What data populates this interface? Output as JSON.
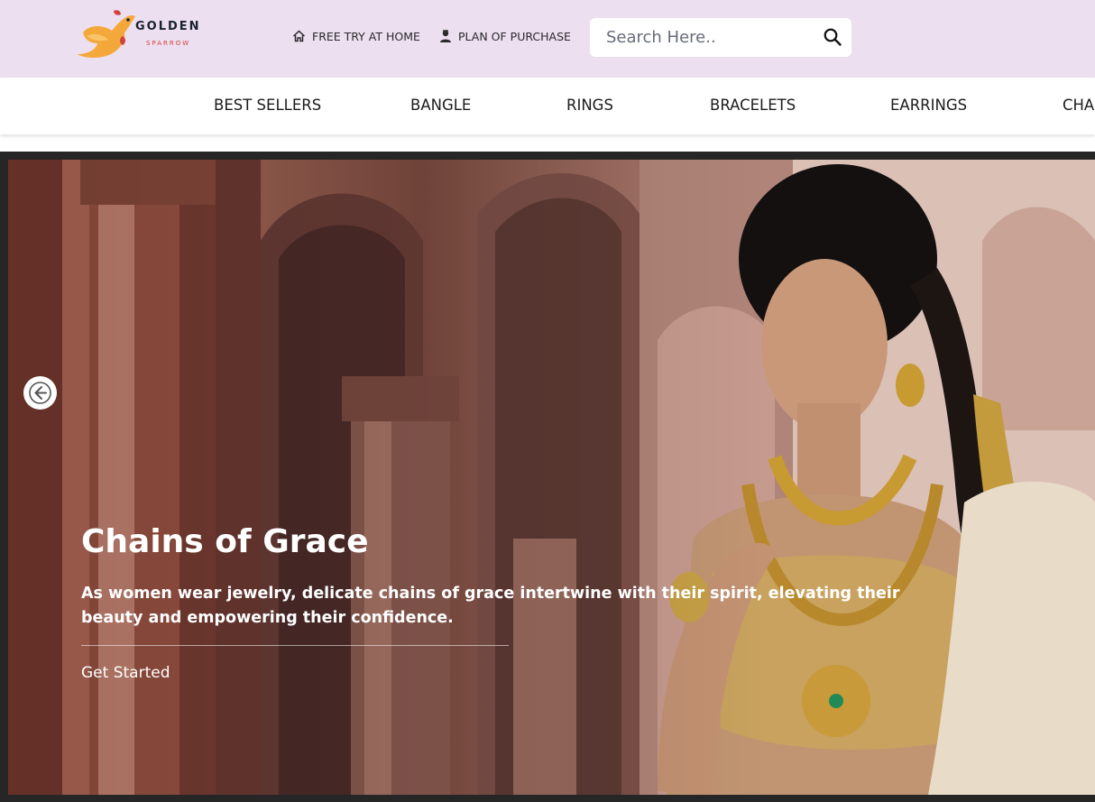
{
  "brand": {
    "name": "GOLDEN",
    "tagline": "SPARROW"
  },
  "header": {
    "links": [
      {
        "label": "FREE TRY AT HOME",
        "icon": "home-icon"
      },
      {
        "label": "PLAN OF PURCHASE",
        "icon": "person-icon"
      }
    ],
    "search": {
      "placeholder": "Search Here..",
      "value": "",
      "icon": "search-icon"
    }
  },
  "nav": {
    "categories": [
      "BEST SELLERS",
      "BANGLE",
      "RINGS",
      "BRACELETS",
      "EARRINGS",
      "CHAINS"
    ]
  },
  "hero": {
    "title": "Chains of Grace",
    "description": "As women wear jewelry, delicate chains of grace intertwine with their spirit, elevating their beauty and empowering their confidence.",
    "cta": "Get Started",
    "prev_icon": "arrow-left-icon"
  },
  "colors": {
    "header_bg": "#ecdff0",
    "nav_bg": "#ffffff",
    "hero_frame": "#262626",
    "logo_accent": "#f4a83a",
    "logo_red": "#d2413a"
  }
}
